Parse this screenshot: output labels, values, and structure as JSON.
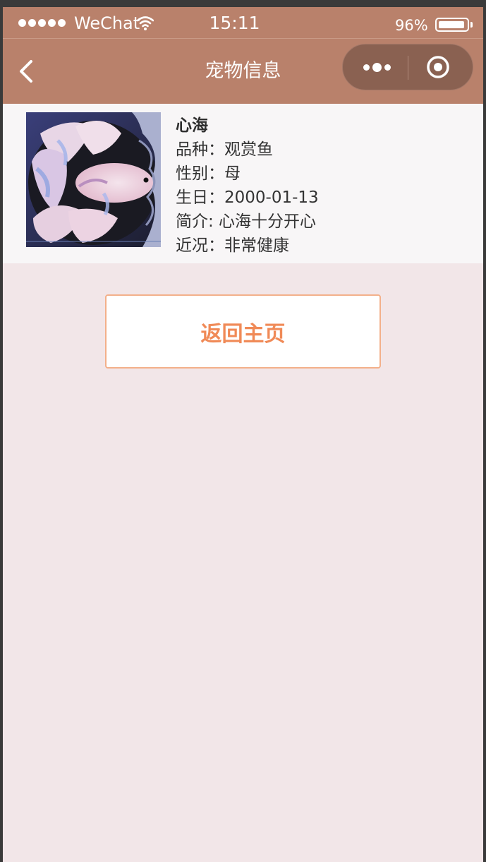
{
  "status_bar": {
    "carrier": "WeChat",
    "time": "15:11",
    "battery_percent": "96%",
    "battery_level": 0.96,
    "signal_icon": "signal-dots-icon",
    "wifi_icon": "wifi-icon"
  },
  "nav": {
    "title": "宠物信息",
    "back_icon": "chevron-left-icon",
    "more_icon": "more-dots-icon",
    "close_icon": "target-circle-icon"
  },
  "pet": {
    "name": "心海",
    "lines": [
      "品种：观赏鱼",
      "性别：母",
      "生日：2000-01-13",
      "简介: 心海十分开心",
      "近况：非常健康"
    ],
    "photo_subject": "betta-fish-photo"
  },
  "actions": {
    "home_button_label": "返回主页"
  },
  "colors": {
    "nav_background": "#b9816b",
    "page_background": "#f2e6e8",
    "button_text": "#f08a57",
    "button_border": "#f3b08a"
  }
}
